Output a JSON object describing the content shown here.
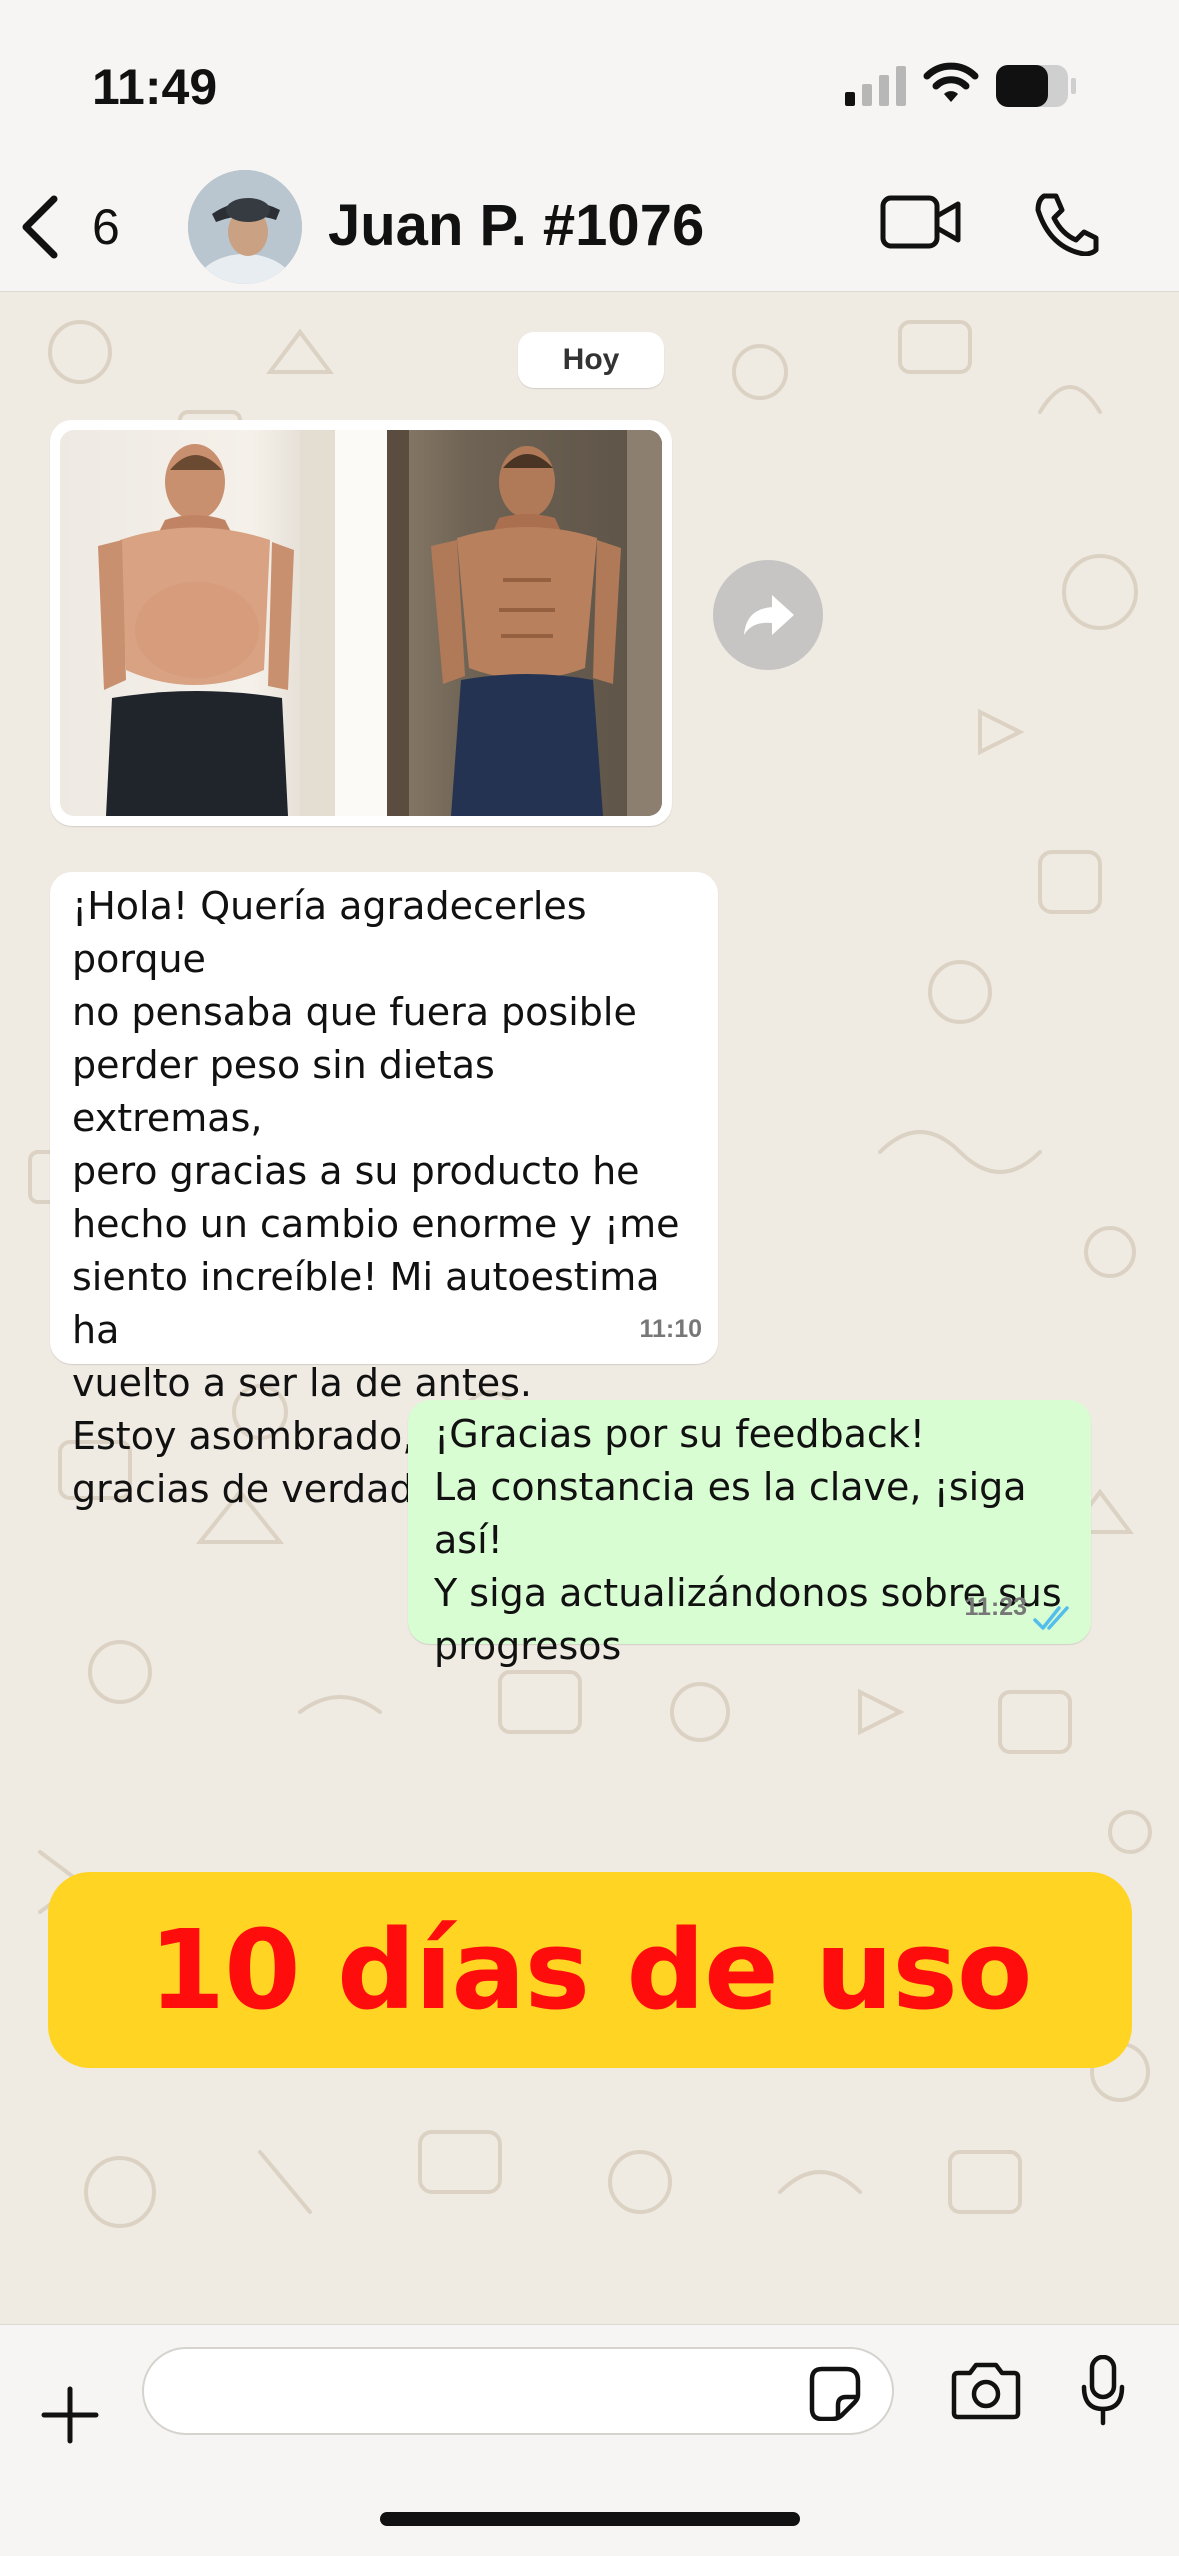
{
  "status_bar": {
    "time": "11:49",
    "icons": [
      "cellular-signal-icon",
      "wifi-icon",
      "battery-icon"
    ]
  },
  "header": {
    "back_count": "6",
    "contact_name": "Juan P. #1076",
    "icons": [
      "back-chevron-icon",
      "video-camera-icon",
      "phone-icon"
    ]
  },
  "chat": {
    "date_label": "Hoy",
    "incoming_message": {
      "text": "¡Hola! Quería agradecerles porque\nno pensaba que fuera posible\nperder peso sin dietas extremas,\npero gracias a su producto he\nhecho un cambio enorme y ¡me\nsiento increíble! Mi autoestima ha\nvuelto a ser la de antes.\n Estoy asombrado, ¡muchas\ngracias de verdad! ",
      "emoji": "💪",
      "time": "11:10"
    },
    "outgoing_message": {
      "text": "¡Gracias por su feedback!\n La constancia es la clave, ¡siga así!\nY siga actualizándonos sobre sus\nprogresos",
      "time": "11:23",
      "status": "read"
    },
    "banner_text": "10 días de uso"
  },
  "composer": {
    "placeholder": "",
    "icons": [
      "plus-icon",
      "sticker-icon",
      "camera-icon",
      "microphone-icon"
    ]
  },
  "colors": {
    "incoming_bubble": "#ffffff",
    "outgoing_bubble": "#d9fdd3",
    "read_ticks": "#53bdeb",
    "banner_bg": "#ffd423",
    "banner_text": "#ff0d0d",
    "chat_bg": "#efeae2"
  }
}
